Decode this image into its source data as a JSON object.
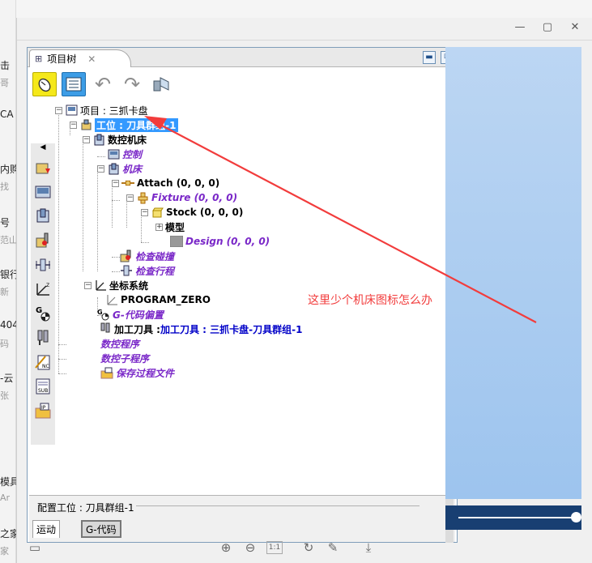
{
  "background": {
    "fragments": [
      "击",
      "CA",
      "内购",
      "号",
      "银行",
      "404",
      "-云",
      "模具",
      "之家"
    ],
    "subfragments": [
      "哥",
      "找",
      "范山",
      "新",
      "码",
      "张",
      "Ar",
      "家"
    ]
  },
  "window": {
    "controls": [
      "—",
      "▢",
      "✕"
    ]
  },
  "panel": {
    "tab_title": "项目树",
    "tab_close": "✕",
    "minimize": "▬",
    "maximize": "⧉"
  },
  "toolbar": {
    "icons": [
      "mouse-icon",
      "list-icon",
      "undo-icon",
      "redo-icon",
      "tool-view-icon"
    ]
  },
  "tree": {
    "project": "项目 : 三抓卡盘",
    "station": "工位 : 刀具群组-1",
    "cnc_machine": "数控机床",
    "control": "控制",
    "machine": "机床",
    "attach": "Attach (0, 0, 0)",
    "fixture": "Fixture (0, 0, 0)",
    "stock": "Stock (0, 0, 0)",
    "model": "模型",
    "design": "Design (0, 0, 0)",
    "collision_check": "检查碰撞",
    "travel_check": "检查行程",
    "coord_system": "坐标系统",
    "program_zero": "PROGRAM_ZERO",
    "gcode_offset": "G-代码偏置",
    "tooling": "加工刀具 : 三抓卡盘-刀具群组-1",
    "nc_program": "数控程序",
    "nc_subprogram": "数控子程序",
    "save_process": "保存过程文件"
  },
  "side_icons": [
    "station-icon",
    "control-icon",
    "machine-icon",
    "collision-icon",
    "travel-icon",
    "coord-icon",
    "gcode-icon",
    "tool-icon",
    "nc-program-icon",
    "sub-icon",
    "ip-icon"
  ],
  "bottom": {
    "config_label": "配置工位 : 刀具群组-1",
    "tab_motion": "运动",
    "tab_gcode": "G-代码"
  },
  "annotation": {
    "text": "这里少个机床图标怎么办",
    "color": "#f23c3c"
  },
  "viewer_toolbar": {
    "page_badge": "1:1"
  }
}
